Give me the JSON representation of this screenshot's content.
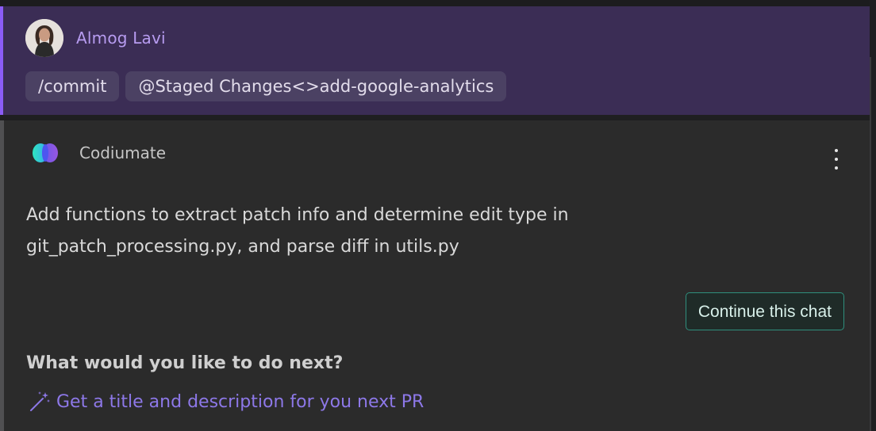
{
  "user": {
    "name": "Almog Lavi",
    "chips": [
      "/commit",
      "@Staged Changes<>add-google-analytics"
    ]
  },
  "assistant": {
    "name": "Codiumate",
    "message": "Add functions to extract patch info and determine edit type in git_patch_processing.py, and parse diff in utils.py",
    "continue_label": "Continue this chat",
    "next_question": "What would you like to do next?",
    "suggestion": "Get a title and description for you next PR"
  },
  "colors": {
    "user_bg": "#3b2d55",
    "user_accent": "#8b5cf6",
    "user_name": "#b79cf0",
    "assistant_bg": "#2b2b2b",
    "button_border": "#2f8f7d",
    "link": "#8d78e8"
  },
  "icons": {
    "assistant_logo": "codiumate-logo-icon",
    "menu": "kebab-menu-icon",
    "suggestion": "magic-wand-icon"
  }
}
